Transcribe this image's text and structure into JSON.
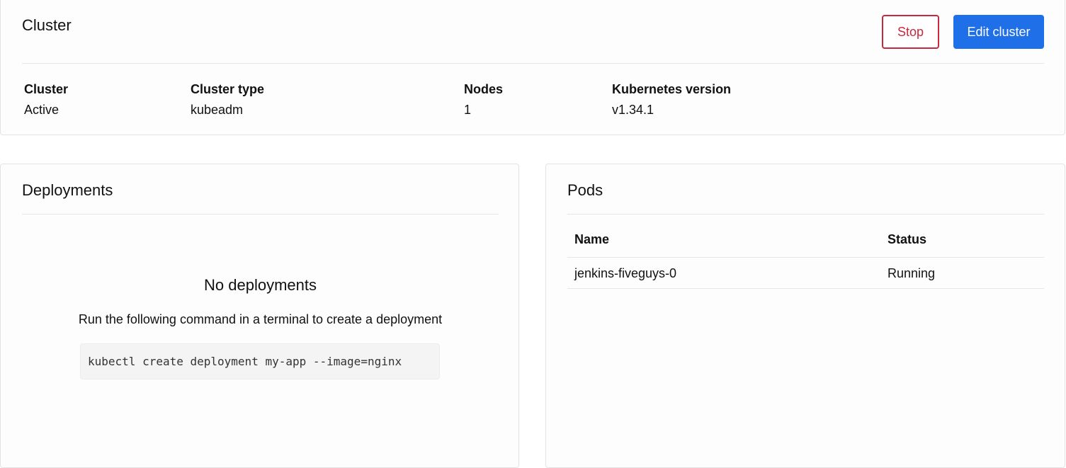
{
  "cluster_card": {
    "title": "Cluster",
    "stop_label": "Stop",
    "edit_label": "Edit cluster",
    "stats": {
      "status": {
        "label": "Cluster",
        "value": "Active"
      },
      "type": {
        "label": "Cluster type",
        "value": "kubeadm"
      },
      "nodes": {
        "label": "Nodes",
        "value": "1"
      },
      "version": {
        "label": "Kubernetes version",
        "value": "v1.34.1"
      }
    }
  },
  "deployments": {
    "title": "Deployments",
    "empty_title": "No deployments",
    "empty_desc": "Run the following command in a terminal to create a deployment",
    "command": "kubectl create deployment my-app --image=nginx"
  },
  "pods": {
    "title": "Pods",
    "columns": [
      "Name",
      "Status"
    ],
    "rows": [
      {
        "name": "jenkins-fiveguys-0",
        "status": "Running"
      }
    ]
  },
  "colors": {
    "primary": "#1f6fe8",
    "danger": "#c9283c"
  }
}
